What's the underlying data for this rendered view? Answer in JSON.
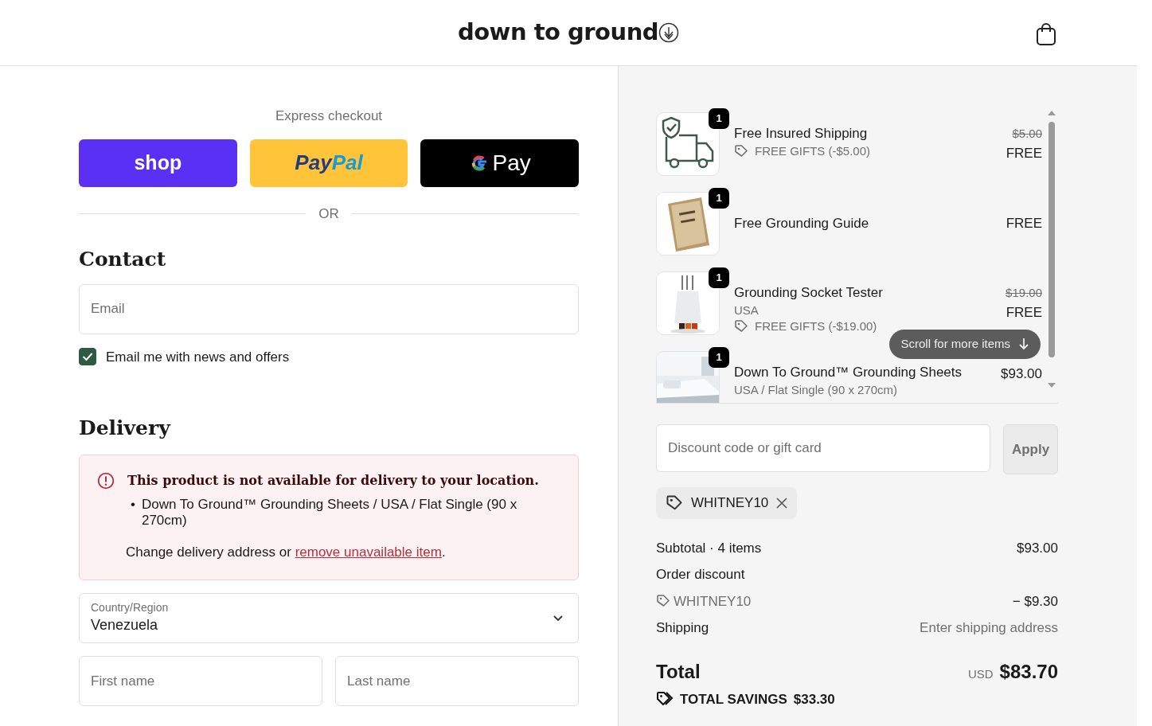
{
  "header": {
    "logo": "down to ground"
  },
  "express": {
    "title": "Express checkout",
    "buttons": [
      {
        "kind": "shop",
        "label_parts": [
          "shop"
        ]
      },
      {
        "kind": "paypal",
        "label_parts": [
          "Pay",
          "Pal"
        ]
      },
      {
        "kind": "gpay",
        "label_parts": [
          "Pay"
        ]
      }
    ],
    "divider": "OR"
  },
  "contact": {
    "heading": "Contact",
    "email": {
      "placeholder": "Email"
    },
    "newsletter": {
      "label": "Email me with news and offers",
      "checked": true
    }
  },
  "delivery": {
    "heading": "Delivery",
    "alert": {
      "title": "This product is not available for delivery to your location.",
      "items": [
        {
          "marker": "•",
          "text": "Down To Ground™ Grounding Sheets / USA / Flat Single (90 x 270cm)"
        }
      ],
      "message": "Change delivery address or ",
      "link": "remove unavailable item",
      "message_end": "."
    },
    "country": {
      "label": "Country/Region",
      "value": "Venezuela"
    },
    "first_name": {
      "placeholder": "First name"
    },
    "last_name": {
      "placeholder": "Last name"
    }
  },
  "cart": {
    "items": [
      {
        "kind": "shipping",
        "quantity": "1",
        "title": "Free Insured Shipping",
        "discount": "FREE GIFTS (-$5.00)",
        "original_price": "$5.00",
        "price": "FREE"
      },
      {
        "kind": "book",
        "quantity": "1",
        "title": "Free Grounding Guide",
        "price": "FREE"
      },
      {
        "kind": "tester",
        "quantity": "1",
        "title": "Grounding Socket Tester",
        "variant": "USA",
        "discount": "FREE GIFTS (-$19.00)",
        "original_price": "$19.00",
        "price": "FREE"
      },
      {
        "kind": "sheets",
        "quantity": "1",
        "title": "Down To Ground™ Grounding Sheets",
        "variant": "USA / Flat Single (90 x 270cm)",
        "price": "$93.00"
      }
    ],
    "scroll_hint": "Scroll for more items"
  },
  "discount": {
    "placeholder": "Discount code or gift card",
    "apply": "Apply",
    "applied_codes": [
      "WHITNEY10"
    ]
  },
  "summary": {
    "subtotal_label": "Subtotal · 4 items",
    "subtotal": "$93.00",
    "discount_label": "Order discount",
    "discount_code": "WHITNEY10",
    "discount_amount": "− $9.30",
    "shipping_label": "Shipping",
    "shipping": "Enter shipping address",
    "total_label": "Total",
    "currency": "USD",
    "total": "$83.70",
    "savings_label": "TOTAL SAVINGS",
    "savings": "$33.30"
  }
}
